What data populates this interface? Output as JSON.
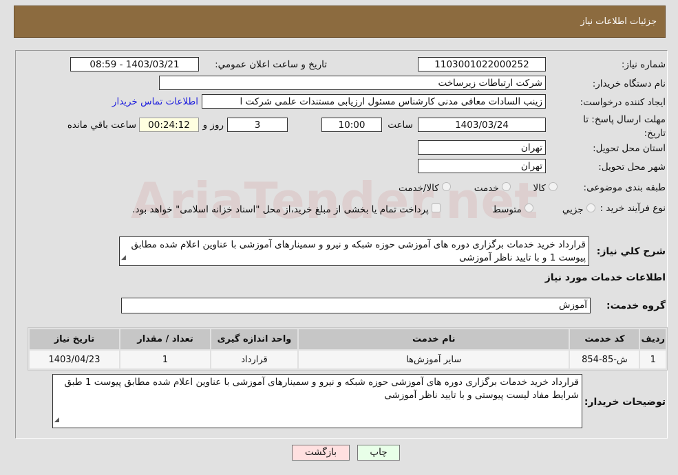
{
  "header": {
    "title": "جزئیات اطلاعات نیاز"
  },
  "fields": {
    "need_number_label": "شماره نیاز:",
    "need_number": "1103001022000252",
    "announce_label": "تاریخ و ساعت اعلان عمومي:",
    "announce_value": "1403/03/21 - 08:59",
    "buyer_org_label": "نام دستگاه خریدار:",
    "buyer_org": "شرکت ارتباطات زيرساخت",
    "creator_label": "ایجاد کننده درخواست:",
    "creator": "زینب السادات معافی مدنی کارشناس مسئول ارزيابی مستندات علمی شرکت ا",
    "contact_link": "اطلاعات تماس خریدار",
    "deadline_label": "مهلت ارسال پاسخ: تا تاریخ:",
    "deadline_date": "1403/03/24",
    "time_label": "ساعت",
    "deadline_time": "10:00",
    "days": "3",
    "days_label": "روز و",
    "remaining": "00:24:12",
    "remaining_label": "ساعت باقي مانده",
    "province_label": "استان محل تحویل:",
    "province": "تهران",
    "city_label": "شهر محل تحویل:",
    "city": "تهران",
    "category_label": "طبقه بندی موضوعی:",
    "category_options": [
      "کالا",
      "خدمت",
      "کالا/خدمت"
    ],
    "process_label": "نوع فرآیند خرید :",
    "process_options": [
      "جزيي",
      "متوسط"
    ],
    "process_note": "پرداخت تمام یا بخشی از مبلغ خرید،از محل \"اسناد خزانه اسلامی\" خواهد بود.",
    "description_label": "شرح کلي نياز:",
    "description": "قرارداد خرید خدمات برگزاری دوره های آموزشی حوزه شبکه و نیرو و سمینارهای آموزشی با عناوین اعلام شده مطابق پیوست 1 و با تایید ناظر آموزشی",
    "services_title": "اطلاعات خدمات مورد نیاز",
    "service_group_label": "گروه خدمت:",
    "service_group": "آموزش",
    "buyer_notes_label": "توضیحات خریدار:",
    "buyer_notes": "قرارداد خرید خدمات برگزاری دوره های آموزشی حوزه شبکه و نیرو و سمینارهای آموزشی با عناوین اعلام شده مطابق پیوست 1 طبق شرایط مفاد لیست پیوستی و با تایید ناظر آموزشی"
  },
  "table": {
    "headers": [
      "رديف",
      "کد خدمت",
      "نام خدمت",
      "واحد اندازه گیری",
      "تعداد / مقدار",
      "تاریخ نیاز"
    ],
    "rows": [
      [
        "1",
        "ش-85-854",
        "سایر آموزش‌ها",
        "قرارداد",
        "1",
        "1403/04/23"
      ]
    ]
  },
  "buttons": {
    "back": "بازگشت",
    "print": "چاپ"
  },
  "watermark": "AriaTender.net",
  "colors": {
    "header": "#8c6b3f",
    "timer_bg": "#ffffe0",
    "back_bg": "#ffe0e0",
    "print_bg": "#e8ffe8",
    "link": "#2222dd"
  }
}
